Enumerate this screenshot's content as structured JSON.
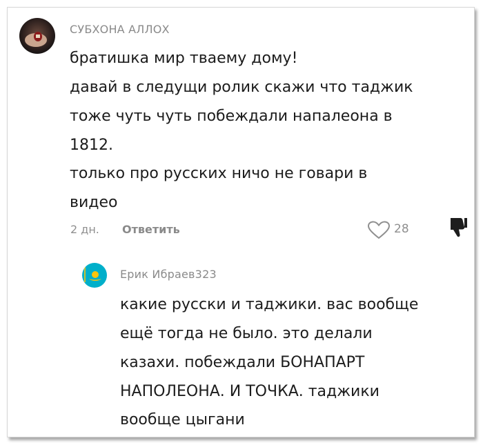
{
  "comment": {
    "author": "СУБХОНА АЛЛОХ",
    "avatar_icon": "avatar-photo-icon",
    "lines": [
      "братишка мир тваему дому!",
      "давай в следущи ролик скажи что таджик",
      "тоже чуть чуть побеждали напалеона в",
      "1812.",
      "только про русских ничо не говари в",
      "видео"
    ],
    "time": "2 дн.",
    "reply_label": "Ответить",
    "like_icon": "heart-outline-icon",
    "like_count": "28",
    "dislike_icon": "thumbs-down-icon"
  },
  "reply": {
    "author": "Ерик Ибраев323",
    "avatar_icon": "kazakhstan-flag-avatar-icon",
    "lines": [
      "какие русски и таджики. вас вообще",
      "ещё тогда не было. это делали",
      "казахи. побеждали БОНАПАРТ",
      "НАПОЛЕОНА. И ТОЧКА. таджики",
      "вообще цыгани"
    ]
  },
  "colors": {
    "meta_gray": "#8f8f8f",
    "text": "#1c1c1c",
    "flag_blue": "#00afca",
    "flag_gold": "#fec50c"
  }
}
